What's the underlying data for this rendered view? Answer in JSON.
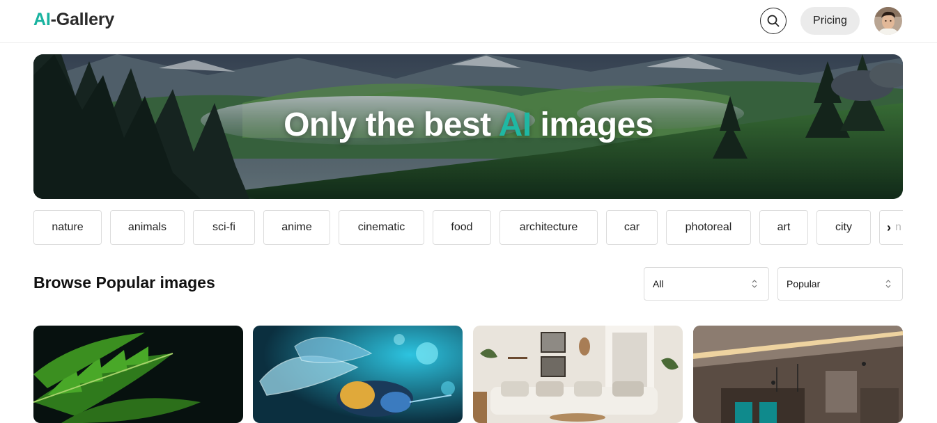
{
  "header": {
    "logo_accent": "AI",
    "logo_rest": "-Gallery",
    "pricing_label": "Pricing"
  },
  "hero": {
    "title_prefix": "Only the best ",
    "title_accent": "AI",
    "title_suffix": " images"
  },
  "categories": [
    "nature",
    "animals",
    "sci-fi",
    "anime",
    "cinematic",
    "food",
    "architecture",
    "car",
    "photoreal",
    "art",
    "city"
  ],
  "categories_next_partial": "n",
  "section": {
    "title": "Browse Popular images"
  },
  "filters": {
    "type_selected": "All",
    "sort_selected": "Popular"
  },
  "gallery": [
    "fern leaf",
    "crystal bee",
    "living room",
    "modern kitchen"
  ],
  "colors": {
    "accent": "#19b3a0",
    "chip_border": "#dcdcdc",
    "pricing_bg": "#ebebeb"
  }
}
